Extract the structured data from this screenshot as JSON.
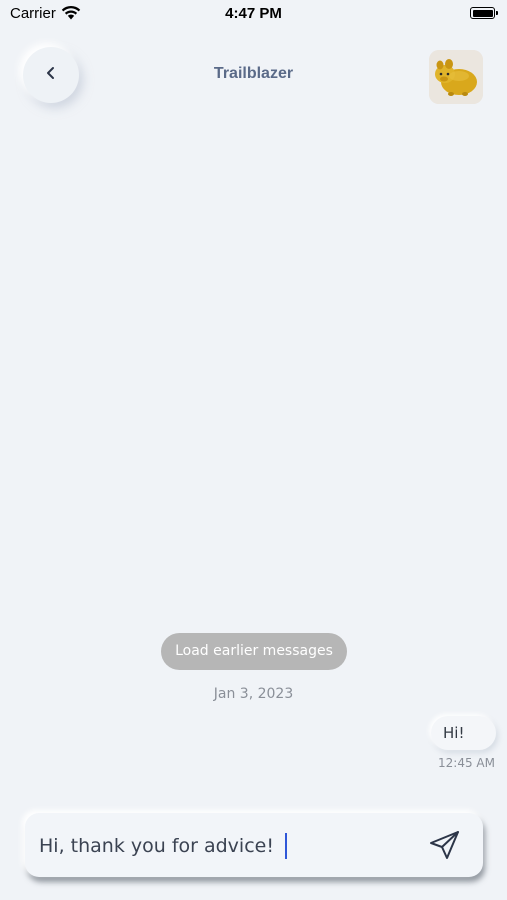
{
  "status_bar": {
    "carrier": "Carrier",
    "time": "4:47 PM",
    "icons": [
      "wifi-icon",
      "battery-icon"
    ]
  },
  "header": {
    "title": "Trailblazer",
    "back_icon": "chevron-left-icon",
    "avatar": "pet-avatar"
  },
  "chat": {
    "load_earlier_label": "Load earlier messages",
    "date": "Jan 3, 2023",
    "messages": [
      {
        "text": "Hi!",
        "time": "12:45 AM",
        "side": "outgoing"
      }
    ]
  },
  "composer": {
    "value": "Hi, thank you for advice!",
    "send_icon": "send-icon"
  },
  "colors": {
    "background": "#f0f3f7",
    "title": "#5a6a88",
    "load_button": "#b6b6b6",
    "caret": "#2f57d8"
  }
}
